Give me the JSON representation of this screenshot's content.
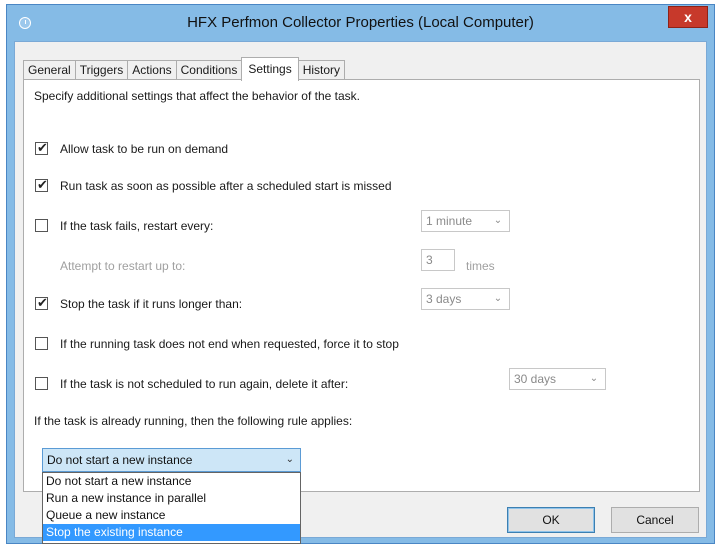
{
  "window": {
    "title": "HFX Perfmon Collector Properties (Local Computer)",
    "close_label": "x"
  },
  "tabs": [
    {
      "label": "General",
      "active": false
    },
    {
      "label": "Triggers",
      "active": false
    },
    {
      "label": "Actions",
      "active": false
    },
    {
      "label": "Conditions",
      "active": false
    },
    {
      "label": "Settings",
      "active": true
    },
    {
      "label": "History",
      "active": false
    }
  ],
  "settings": {
    "intro": "Specify additional settings that affect the behavior of the task.",
    "allow_on_demand": {
      "label": "Allow task to be run on demand",
      "checked": true
    },
    "run_asap": {
      "label": "Run task as soon as possible after a scheduled start is missed",
      "checked": true
    },
    "restart_on_fail": {
      "label": "If the task fails, restart every:",
      "checked": false,
      "interval": "1 minute"
    },
    "restart_attempts": {
      "label": "Attempt to restart up to:",
      "value": "3",
      "unit": "times"
    },
    "stop_if_long": {
      "label": "Stop the task if it runs longer than:",
      "checked": true,
      "duration": "3 days"
    },
    "force_stop": {
      "label": "If the running task does not end when requested, force it to stop",
      "checked": false
    },
    "delete_after": {
      "label": "If the task is not scheduled to run again, delete it after:",
      "checked": false,
      "duration": "30 days"
    },
    "rule_label": "If the task is already running, then the following rule applies:",
    "rule_selected": "Do not start a new instance",
    "rule_options": [
      "Do not start a new instance",
      "Run a new instance in parallel",
      "Queue a new instance",
      "Stop the existing instance"
    ],
    "rule_highlighted_index": 3
  },
  "buttons": {
    "ok": "OK",
    "cancel": "Cancel"
  },
  "icons": {
    "check": "✔",
    "combo_arrow": "chevron-down-icon"
  },
  "colors": {
    "title_bar": "#85bbe6",
    "close_button": "#c7392b",
    "selection": "#3399ff"
  }
}
